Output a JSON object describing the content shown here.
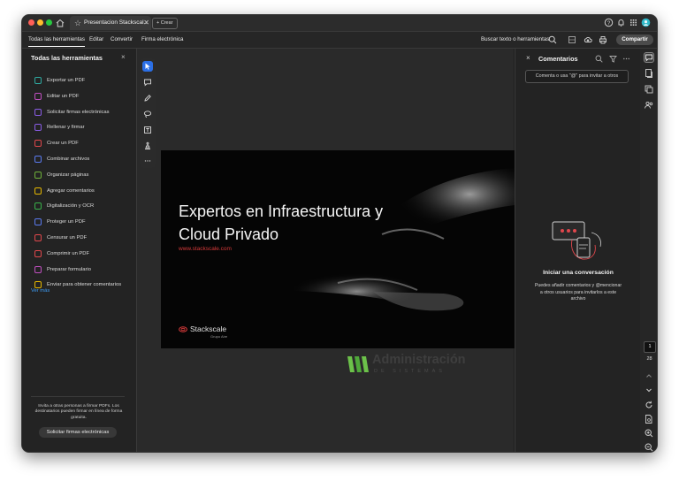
{
  "titlebar": {
    "tab_title": "Presentacion Stackscal...",
    "tab_close": "✕",
    "new_tab_label": "+ Crear",
    "traffic_colors": [
      "#ff5f57",
      "#febc2e",
      "#28c840"
    ]
  },
  "menubar": {
    "items": [
      "Todas las herramientas",
      "Editar",
      "Convertir",
      "Firma electrónica"
    ],
    "search_label": "Buscar texto o herramientas",
    "share_label": "Compartir"
  },
  "tools_panel": {
    "title": "Todas las herramientas",
    "close": "×",
    "items": [
      {
        "label": "Exportar un PDF",
        "icon": "export-pdf-icon",
        "color": "#2fa9a0"
      },
      {
        "label": "Editar un PDF",
        "icon": "edit-pdf-icon",
        "color": "#c04fc0"
      },
      {
        "label": "Solicitar firmas electrónicas",
        "icon": "request-signature-icon",
        "color": "#8a5ce6"
      },
      {
        "label": "Rellenar y firmar",
        "icon": "fill-sign-icon",
        "color": "#8a5ce6"
      },
      {
        "label": "Crear un PDF",
        "icon": "create-pdf-icon",
        "color": "#e0474c"
      },
      {
        "label": "Combinar archivos",
        "icon": "combine-icon",
        "color": "#5b7bf0"
      },
      {
        "label": "Organizar páginas",
        "icon": "organize-pages-icon",
        "color": "#6fb23a"
      },
      {
        "label": "Agregar comentarios",
        "icon": "comment-icon",
        "color": "#e6b800"
      },
      {
        "label": "Digitalización y OCR",
        "icon": "scan-ocr-icon",
        "color": "#39b24a"
      },
      {
        "label": "Proteger un PDF",
        "icon": "protect-icon",
        "color": "#5b7bf0"
      },
      {
        "label": "Censurar un PDF",
        "icon": "redact-icon",
        "color": "#e0474c"
      },
      {
        "label": "Comprimir un PDF",
        "icon": "compress-icon",
        "color": "#e0474c"
      },
      {
        "label": "Preparar formulario",
        "icon": "form-icon",
        "color": "#c04fc0"
      },
      {
        "label": "Enviar para obtener comentarios",
        "icon": "send-comments-icon",
        "color": "#e6b800"
      }
    ],
    "see_more": "Ver más",
    "invite_note": "Invita a otras personas a firmar PDFs. Los destinatarios pueden firmar en línea de forma gratuita.",
    "invite_button": "Solicitar firmas electrónicas"
  },
  "slide": {
    "title": "Expertos en Infraestructura y\nCloud Privado",
    "url": "www.stackscale.com",
    "logo_text": "Stackscale",
    "logo_sub": "Grupo Aire"
  },
  "watermark": {
    "title": "Administración",
    "subtitle": "DE SISTEMAS"
  },
  "comments": {
    "close": "×",
    "title": "Comentarios",
    "input_placeholder": "Comenta o usa \"@\" para invitar a otros",
    "empty_title": "Iniciar una conversación",
    "empty_text": "Puedes añadir comentarios y @mencionar a otros usuarios para invitarlos a este archivo"
  },
  "pager": {
    "current": "1",
    "total": "28"
  },
  "colors": {
    "accent_blue": "#2b6fe6",
    "slide_url_red": "#d83a3a",
    "watermark_green": "#6cc24a"
  }
}
